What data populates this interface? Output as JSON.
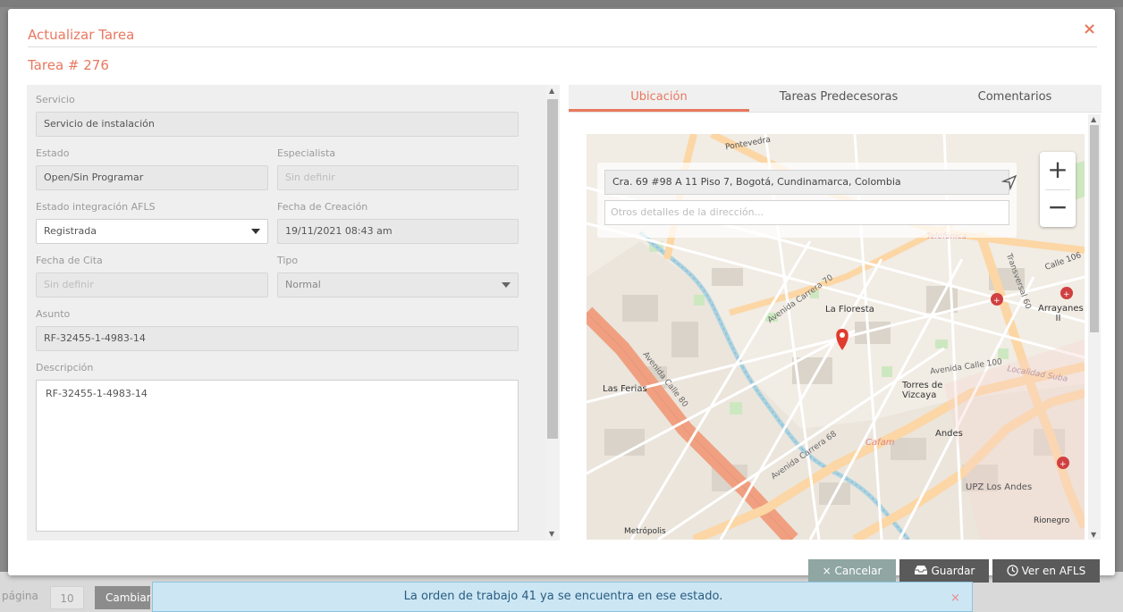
{
  "modal": {
    "title": "Actualizar Tarea",
    "close": "×",
    "task_number": "Tarea # 276"
  },
  "form": {
    "servicio": {
      "label": "Servicio",
      "value": "Servicio de instalación"
    },
    "estado": {
      "label": "Estado",
      "value": "Open/Sin Programar"
    },
    "especialista": {
      "label": "Especialista",
      "placeholder": "Sin definir"
    },
    "estado_afls": {
      "label": "Estado integración AFLS",
      "value": "Registrada"
    },
    "fecha_creacion": {
      "label": "Fecha de Creación",
      "value": "19/11/2021 08:43 am"
    },
    "fecha_cita": {
      "label": "Fecha de Cita",
      "placeholder": "Sin definir"
    },
    "tipo": {
      "label": "Tipo",
      "value": "Normal"
    },
    "asunto": {
      "label": "Asunto",
      "value": "RF-32455-1-4983-14"
    },
    "descripcion": {
      "label": "Descripción",
      "value": "RF-32455-1-4983-14"
    }
  },
  "tabs": [
    {
      "label": "Ubicación",
      "active": true
    },
    {
      "label": "Tareas Predecesoras",
      "active": false
    },
    {
      "label": "Comentarios",
      "active": false
    }
  ],
  "map": {
    "address": "Cra. 69 #98 A 11 Piso 7, Bogotá, Cundinamarca, Colombia",
    "address_detail_placeholder": "Otros detalles de la dirección...",
    "zoom_in": "+",
    "zoom_out": "−",
    "labels": {
      "la_floresta": "La Floresta",
      "las_ferias": "Las Ferias",
      "torres_de_vizcaya": "Torres de Vizcaya",
      "andes": "Andes",
      "upz_los_andes": "UPZ Los Andes",
      "avenida_calle_100": "Avenida Calle 100",
      "avenida_calle_80": "Avenida Calle 80",
      "avenida_carrera_68": "Avenida Carrera 68",
      "avenida_carrera_70": "Avenida Carrera 70",
      "transversal_60": "Transversal 60",
      "cafam": "Cafam",
      "arrayanes": "Arrayanes II",
      "rionegro": "Rionegro",
      "metropolis": "Metrópolis",
      "telefonica": "Telefónica",
      "localidad_suba": "Localidad Suba",
      "calle_106": "Calle 106",
      "pontevedra": "Pontevedra"
    }
  },
  "buttons": {
    "cancel": "× Cancelar",
    "save": "Guardar",
    "ver_afls": "Ver en AFLS"
  },
  "toast": {
    "message": "La orden de trabajo 41 ya se encuentra en ese estado.",
    "close": "×"
  },
  "background": {
    "pagination_label": "página",
    "page_size": "10",
    "change_button": "Cambiar"
  },
  "colors": {
    "accent": "#e8785f",
    "cancel_button": "#8fa6a2",
    "dark_button": "#5a5a5a",
    "toast_bg": "#cce6f4"
  }
}
